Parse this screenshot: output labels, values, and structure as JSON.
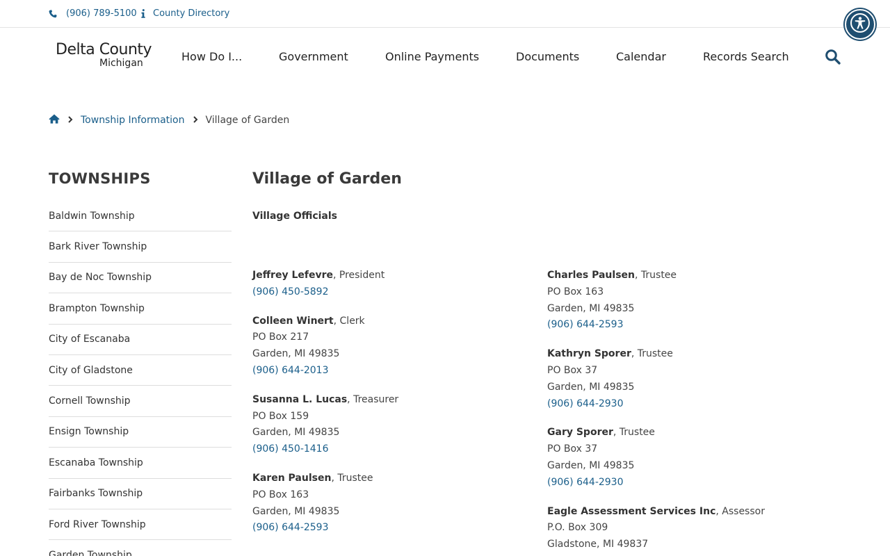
{
  "utility": {
    "phone": "(906) 789-5100",
    "directory": "County Directory"
  },
  "logo": {
    "line1": "Delta County",
    "line2": "Michigan"
  },
  "nav": [
    {
      "label": "How Do I..."
    },
    {
      "label": "Government"
    },
    {
      "label": "Online Payments"
    },
    {
      "label": "Documents"
    },
    {
      "label": "Calendar"
    },
    {
      "label": "Records Search"
    }
  ],
  "breadcrumb": {
    "parent": "Township Information",
    "current": "Village of Garden"
  },
  "sidebar": {
    "title": "TOWNSHIPS",
    "items": [
      "Baldwin Township",
      "Bark River Township",
      "Bay de Noc Township",
      "Brampton Township",
      "City of Escanaba",
      "City of Gladstone",
      "Cornell Township",
      "Ensign Township",
      "Escanaba Township",
      "Fairbanks Township",
      "Ford River Township",
      "Garden Township"
    ]
  },
  "page": {
    "title": "Village of Garden",
    "section": "Village Officials"
  },
  "officials_left": [
    {
      "name": "Jeffrey Lefevre",
      "role": ", President",
      "box": "",
      "city": "",
      "phone": "(906) 450-5892"
    },
    {
      "name": "Colleen Winert",
      "role": ", Clerk",
      "box": "PO Box 217",
      "city": "Garden, MI 49835",
      "phone": "(906) 644-2013"
    },
    {
      "name": "Susanna L. Lucas",
      "role": ", Treasurer",
      "box": "PO Box 159",
      "city": "Garden, MI 49835",
      "phone": "(906) 450-1416"
    },
    {
      "name": "Karen Paulsen",
      "role": ", Trustee",
      "box": "PO Box 163",
      "city": "Garden, MI 49835",
      "phone": "(906) 644-2593"
    }
  ],
  "officials_right": [
    {
      "name": "Charles Paulsen",
      "role": ", Trustee",
      "box": "PO Box 163",
      "city": "Garden, MI 49835",
      "phone": "(906) 644-2593"
    },
    {
      "name": "Kathryn Sporer",
      "role": ", Trustee",
      "box": "PO Box 37",
      "city": "Garden, MI 49835",
      "phone": "(906) 644-2930"
    },
    {
      "name": "Gary Sporer",
      "role": ", Trustee",
      "box": "PO Box 37",
      "city": "Garden, MI 49835",
      "phone": "(906) 644-2930"
    },
    {
      "name": "Eagle Assessment Services Inc",
      "role": ", Assessor",
      "box": "P.O. Box 309",
      "city": "Gladstone, MI 49837",
      "phone": ""
    }
  ],
  "colors": {
    "link": "#1a5e8a",
    "text": "#333333",
    "accessibility_button": "#1f4e70"
  },
  "icons": [
    "phone-icon",
    "info-icon",
    "accessibility-icon",
    "search-icon",
    "home-icon",
    "chevron-right-icon"
  ]
}
